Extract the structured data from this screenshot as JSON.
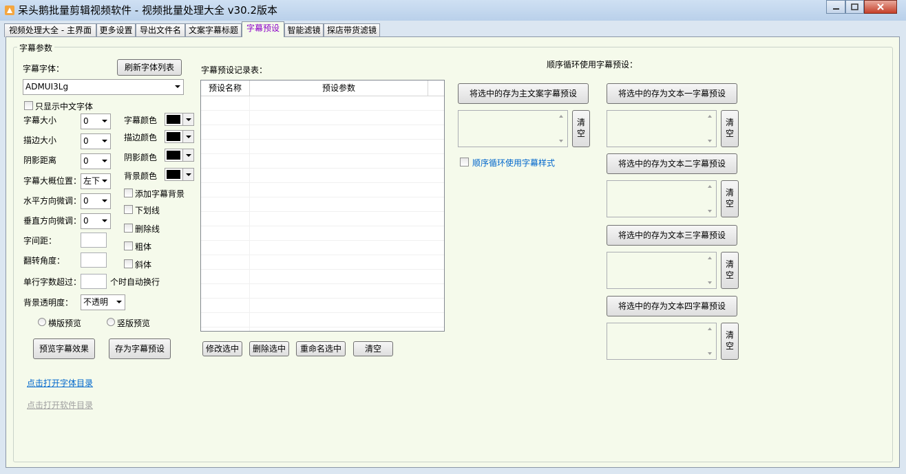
{
  "window": {
    "title": "呆头鹅批量剪辑视频软件 -  视频批量处理大全  v30.2版本"
  },
  "tabs": [
    {
      "label": "视频处理大全 - 主界面"
    },
    {
      "label": "更多设置"
    },
    {
      "label": "导出文件名"
    },
    {
      "label": "文案字幕标题"
    },
    {
      "label": "字幕预设",
      "active": true
    },
    {
      "label": "智能滤镜"
    },
    {
      "label": "探店带货滤镜"
    }
  ],
  "subtitle_params": {
    "group_title": "字幕参数",
    "font_label": "字幕字体：",
    "refresh_font_button": "刷新字体列表",
    "font_value": "ADMUI3Lg",
    "only_chinese_fonts": "只显示中文字体",
    "size_label": "字幕大小",
    "size_value": "0",
    "stroke_size_label": "描边大小",
    "stroke_size_value": "0",
    "shadow_distance_label": "阴影距离",
    "shadow_distance_value": "0",
    "position_label": "字幕大概位置：",
    "position_value": "左下",
    "h_adjust_label": "水平方向微调：",
    "h_adjust_value": "0",
    "v_adjust_label": "垂直方向微调：",
    "v_adjust_value": "0",
    "char_spacing_label": "字间距：",
    "rotation_label": "翻转角度：",
    "wrap_label_prefix": "单行字数超过：",
    "wrap_label_suffix": "个时自动换行",
    "bg_opacity_label": "背景透明度：",
    "bg_opacity_value": "不透明",
    "color_label": "字幕颜色",
    "stroke_color_label": "描边颜色",
    "shadow_color_label": "阴影颜色",
    "bg_color_label": "背景颜色",
    "add_bg_label": "添加字幕背景",
    "underline_label": "下划线",
    "strikethrough_label": "删除线",
    "bold_label": "粗体",
    "italic_label": "斜体",
    "horizontal_preview_label": "横版预览",
    "vertical_preview_label": "竖版预览",
    "preview_button": "预览字幕效果",
    "save_preset_button": "存为字幕预设",
    "open_font_dir_link": "点击打开字体目录",
    "open_software_dir_link": "点击打开软件目录",
    "colors": {
      "swatch": "#000000"
    }
  },
  "preset_table": {
    "title": "字幕预设记录表：",
    "columns": [
      "预设名称",
      "预设参数"
    ],
    "rows": [],
    "modify_button": "修改选中",
    "delete_button": "删除选中",
    "rename_button": "重命名选中",
    "clear_button": "清空"
  },
  "sequence": {
    "title": "顺序循环使用字幕预设：",
    "main_button": "将选中的存为主文案字幕预设",
    "main_clear": "清\n空",
    "cycle_style_label": "顺序循环使用字幕样式",
    "text1_button": "将选中的存为文本一字幕预设",
    "text2_button": "将选中的存为文本二字幕预设",
    "text3_button": "将选中的存为文本三字幕预设",
    "text4_button": "将选中的存为文本四字幕预设",
    "clear_label": "清\n空"
  }
}
